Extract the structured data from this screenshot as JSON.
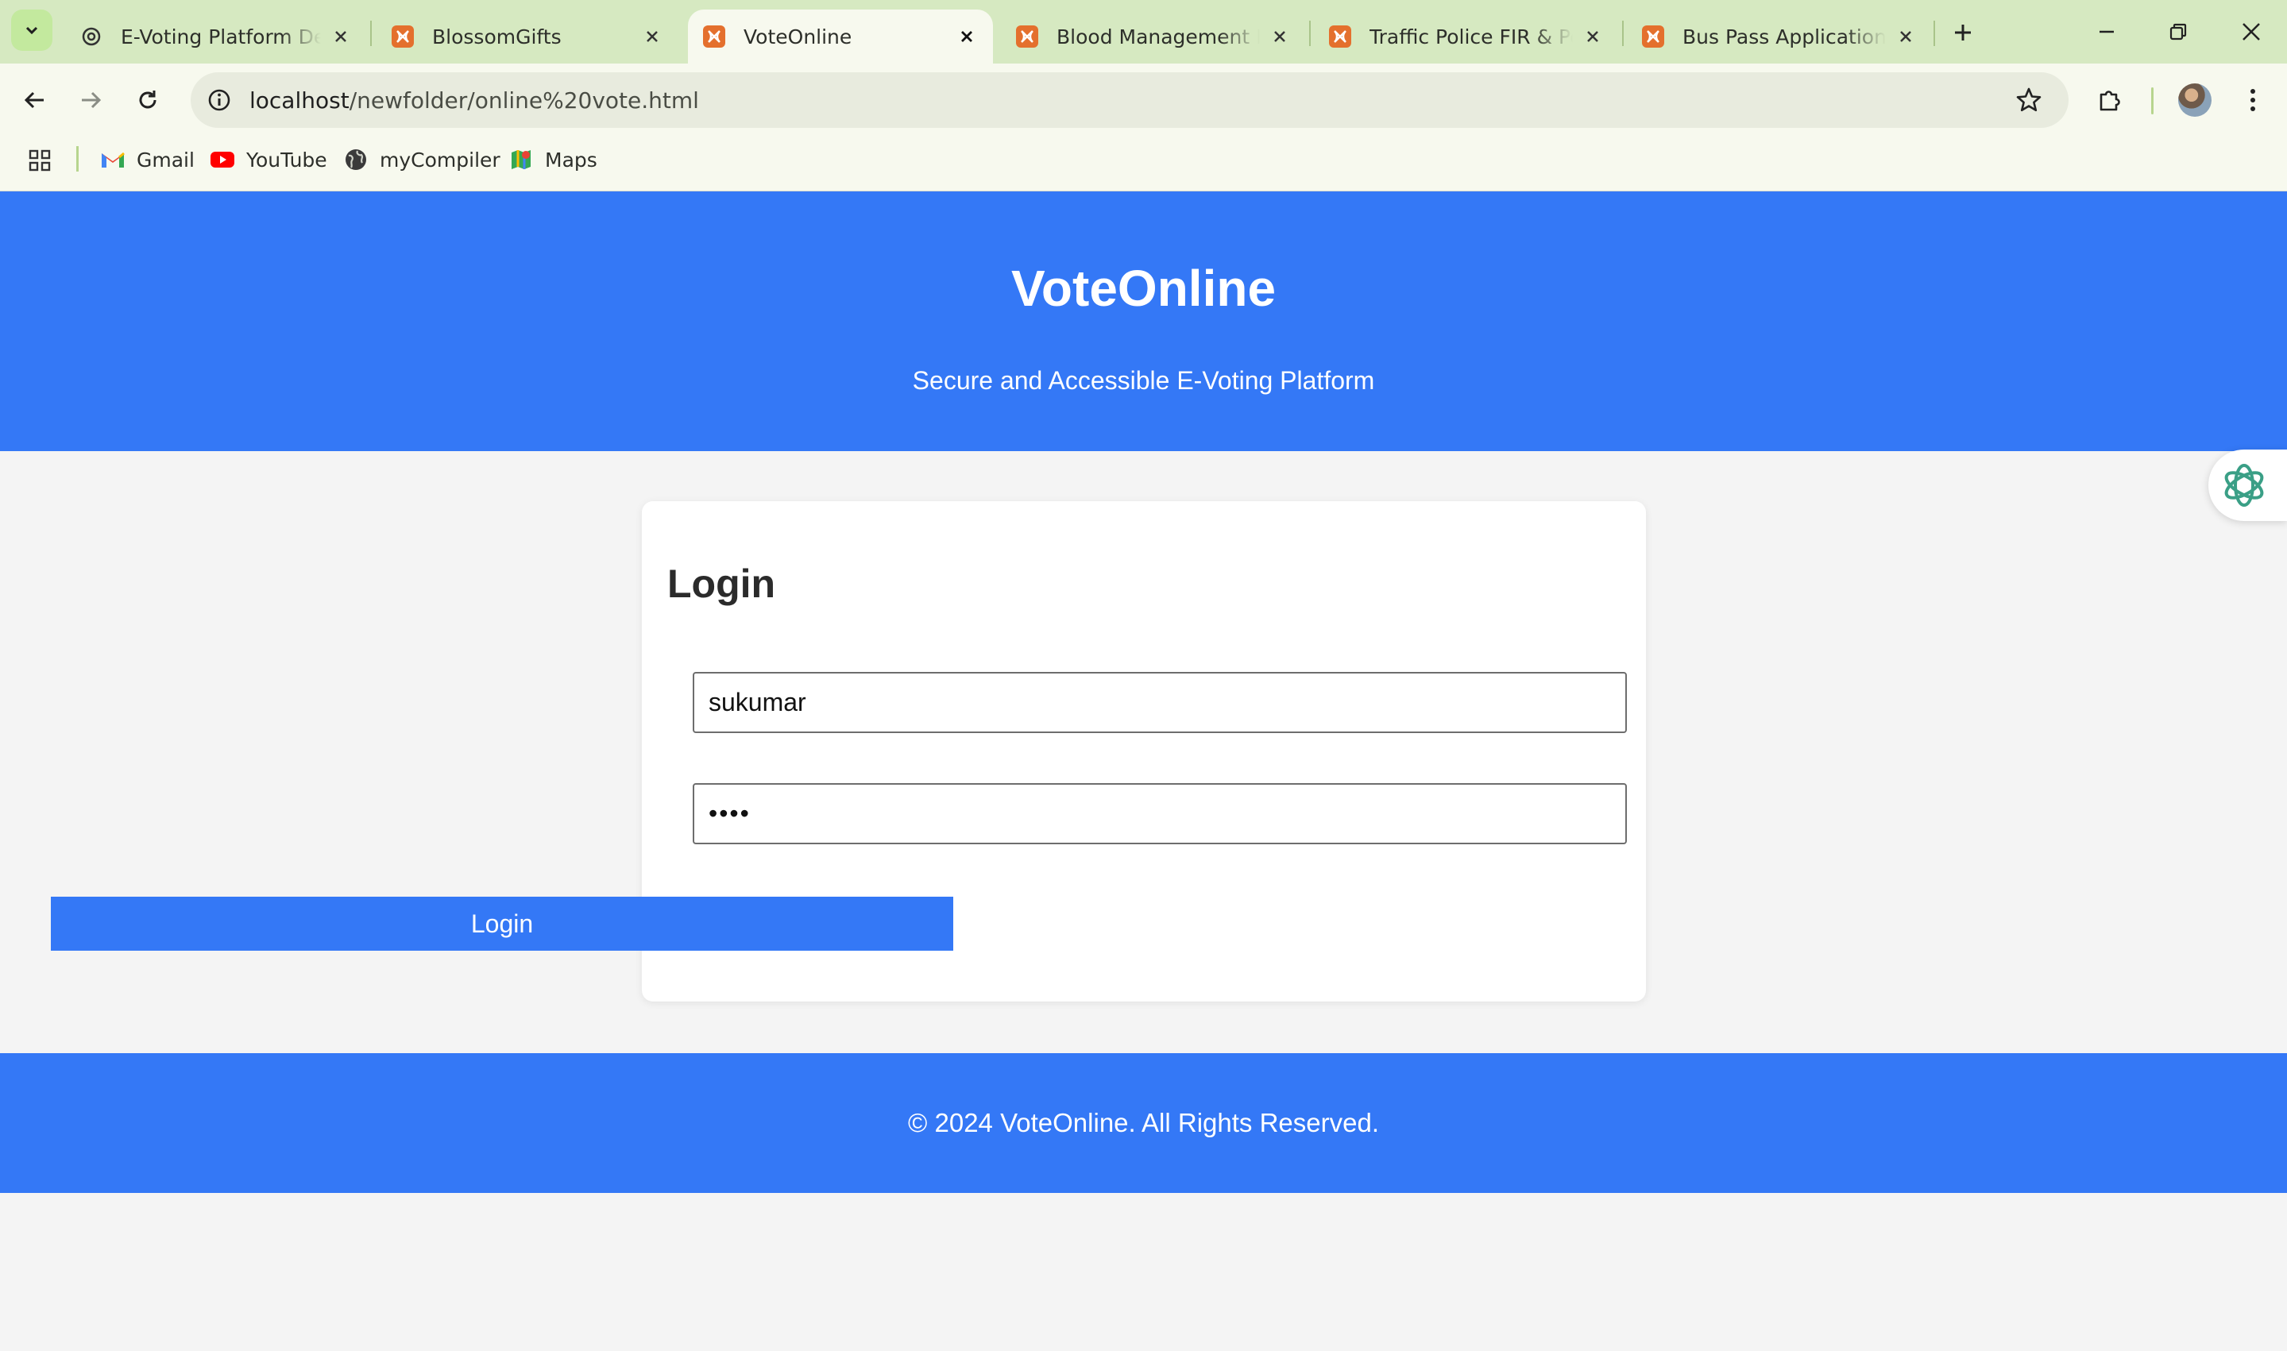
{
  "browser": {
    "tabs": [
      {
        "title": "E-Voting Platform Desig",
        "favicon": "chatgpt-icon",
        "active": false
      },
      {
        "title": "BlossomGifts",
        "favicon": "xampp-icon",
        "active": false
      },
      {
        "title": "VoteOnline",
        "favicon": "xampp-icon",
        "active": true
      },
      {
        "title": "Blood Management Info",
        "favicon": "xampp-icon",
        "active": false
      },
      {
        "title": "Traffic Police FIR & Pena",
        "favicon": "xampp-icon",
        "active": false
      },
      {
        "title": "Bus Pass Application Sy",
        "favicon": "xampp-icon",
        "active": false
      }
    ],
    "url_host": "localhost",
    "url_path": "/newfolder/online%20vote.html",
    "bookmarks": [
      {
        "label": "Gmail",
        "icon": "gmail-icon"
      },
      {
        "label": "YouTube",
        "icon": "youtube-icon"
      },
      {
        "label": "myCompiler",
        "icon": "globe-icon"
      },
      {
        "label": "Maps",
        "icon": "maps-icon"
      }
    ],
    "colors": {
      "tabstrip": "#d6e9c1",
      "toolbar": "#f7f9ee",
      "omnibox": "#e8ebde"
    }
  },
  "site": {
    "title": "VoteOnline",
    "tagline": "Secure and Accessible E-Voting Platform",
    "login": {
      "heading": "Login",
      "username_value": "sukumar",
      "password_value": "••••",
      "button_label": "Login"
    },
    "footer": "© 2024 VoteOnline. All Rights Reserved.",
    "colors": {
      "primary": "#3478f6",
      "background": "#f4f4f4",
      "card": "#ffffff"
    }
  }
}
